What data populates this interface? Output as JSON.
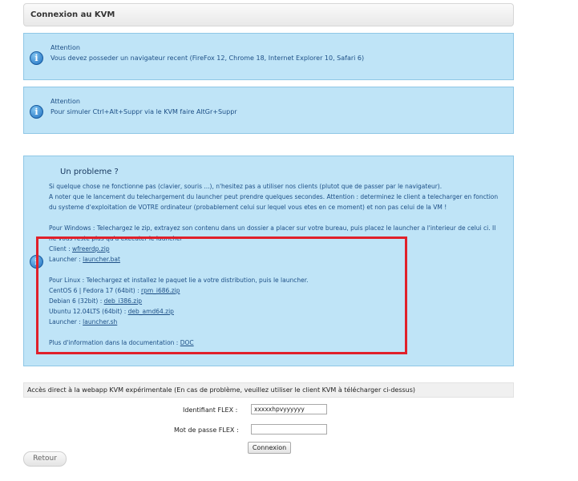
{
  "header": {
    "title": "Connexion au KVM"
  },
  "alert1": {
    "title": "Attention",
    "text": "Vous devez posseder un navigateur recent (FireFox 12, Chrome 18, Internet Explorer 10, Safari 6)"
  },
  "alert2": {
    "title": "Attention",
    "text": "Pour simuler Ctrl+Alt+Suppr via le KVM faire AltGr+Suppr"
  },
  "problem": {
    "title": "Un probleme ?",
    "line1": "Si quelque chose ne fonctionne pas (clavier, souris ...), n'hesitez pas a utiliser nos clients (plutot que de passer par le navigateur).",
    "line2": "A noter que le lancement du telechargement du launcher peut prendre quelques secondes. Attention : determinez le client a telecharger en fonction",
    "line3": "du systeme d'exploitation de VOTRE ordinateur (probablement celui sur lequel vous etes en ce moment) et non pas celui de la VM !",
    "windows_line1": "Pour Windows : Telechargez le zip, extrayez son contenu dans un dossier a placer sur votre bureau, puis placez le launcher a l'interieur de celui ci. Il",
    "windows_line2": "ne vous reste plus qu'a executer le launcher",
    "client_label": "Client : ",
    "client_link": "wfreerdp.zip",
    "launcher_label": "Launcher : ",
    "launcher_bat": "launcher.bat",
    "linux_line": "Pour Linux : Telechargez et installez le paquet lie a votre distribution, puis le launcher.",
    "centos_label": "CentOS 6 | Fedora 17 (64bit) : ",
    "centos_link": "rpm_i686.zip",
    "debian_label": "Debian 6 (32bit) : ",
    "debian_link": "deb_i386.zip",
    "ubuntu_label": "Ubuntu 12.04LTS (64bit) : ",
    "ubuntu_link": "deb_amd64.zip",
    "launcher2_label": "Launcher : ",
    "launcher_sh": "launcher.sh",
    "doc_label": "Plus d'information dans la documentation : ",
    "doc_link": "DOC"
  },
  "direct": {
    "title": "Accès direct à la webapp KVM expérimentale (En cas de problème, veuillez utiliser le client KVM à télécharger ci-dessus)",
    "id_label": "Identifiant FLEX :",
    "id_value": "xxxxxhpvyyyyyy",
    "pwd_label": "Mot de passe FLEX :",
    "pwd_value": "",
    "connect_button": "Connexion"
  },
  "back_button": "Retour",
  "icons": {
    "info": "info-icon"
  },
  "colors": {
    "alert_bg": "#bfe4f7",
    "highlight": "#e0202a",
    "text": "#1d4f86"
  }
}
